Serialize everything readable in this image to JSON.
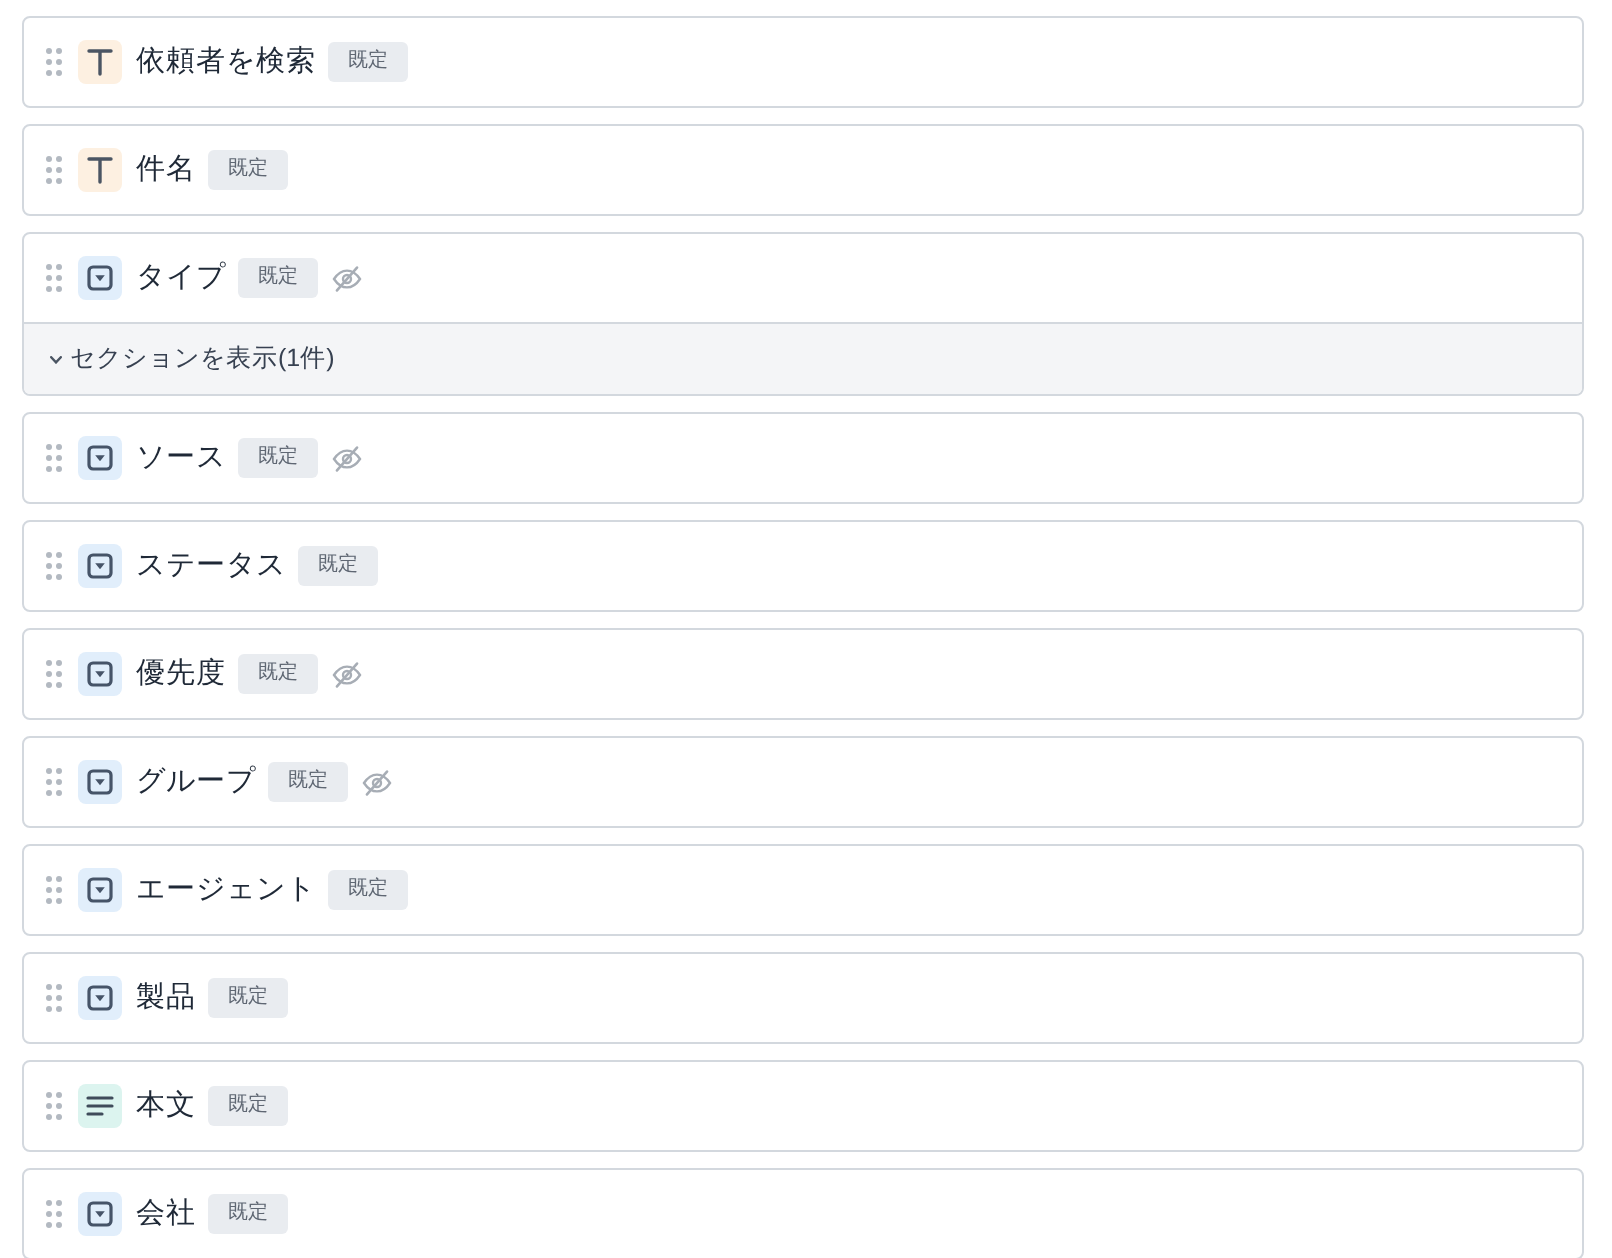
{
  "fields": [
    {
      "label": "依頼者を検索",
      "kind": "text",
      "badge": "既定",
      "hidden": false
    },
    {
      "label": "件名",
      "kind": "text",
      "badge": "既定",
      "hidden": false
    },
    {
      "label": "タイプ",
      "kind": "dropdown",
      "badge": "既定",
      "hidden": true,
      "section_toggle": {
        "label": "セクションを表示(1件)"
      }
    },
    {
      "label": "ソース",
      "kind": "dropdown",
      "badge": "既定",
      "hidden": true
    },
    {
      "label": "ステータス",
      "kind": "dropdown",
      "badge": "既定",
      "hidden": false
    },
    {
      "label": "優先度",
      "kind": "dropdown",
      "badge": "既定",
      "hidden": true
    },
    {
      "label": "グループ",
      "kind": "dropdown",
      "badge": "既定",
      "hidden": true
    },
    {
      "label": "エージェント",
      "kind": "dropdown",
      "badge": "既定",
      "hidden": false
    },
    {
      "label": "製品",
      "kind": "dropdown",
      "badge": "既定",
      "hidden": false
    },
    {
      "label": "本文",
      "kind": "paragraph",
      "badge": "既定",
      "hidden": false
    },
    {
      "label": "会社",
      "kind": "dropdown",
      "badge": "既定",
      "hidden": false
    }
  ]
}
